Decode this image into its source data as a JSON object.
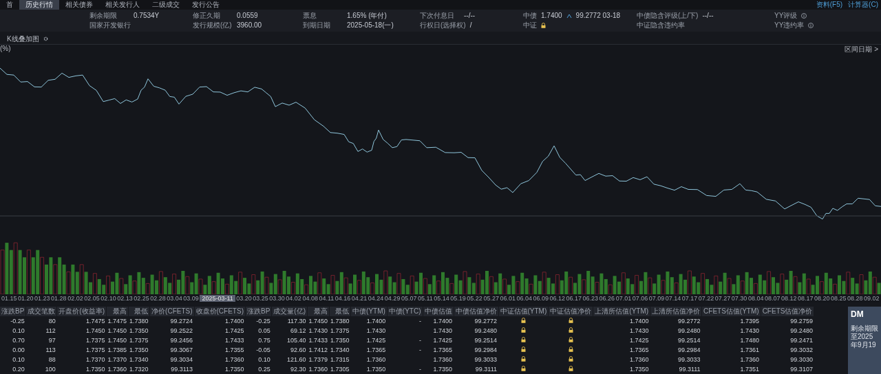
{
  "top_tabs": [
    {
      "label": "首",
      "selected": false
    },
    {
      "label": "历史行情",
      "selected": true
    },
    {
      "label": "相关债券",
      "selected": false
    },
    {
      "label": "相关发行人",
      "selected": false
    },
    {
      "label": "二级成交",
      "selected": false
    },
    {
      "label": "发行公告",
      "selected": false
    }
  ],
  "links": [
    "资料(F5)",
    "计算器(C)"
  ],
  "info_rows": [
    [
      {
        "kind": "pair",
        "label": "剩余期限",
        "value": "0.7534Y"
      },
      {
        "kind": "pair",
        "label": "修正久期",
        "value": "0.0559"
      },
      {
        "kind": "pair",
        "label": "票息",
        "value": "1.65% (年付)"
      },
      {
        "kind": "pair",
        "label": "下次付息日",
        "value": "--/--"
      },
      {
        "kind": "valuation",
        "label": "中债",
        "value": "1.7400",
        "extra": "99.2772 03-18"
      },
      {
        "kind": "pair",
        "label": "中债隐含评级(上/下)",
        "value": "--/--"
      },
      {
        "kind": "info",
        "label": "YY评级"
      }
    ],
    [
      {
        "kind": "pair",
        "label": "国家开发银行"
      },
      {
        "kind": "pair",
        "label": "发行规模(亿)",
        "value": "3960.00"
      },
      {
        "kind": "pair",
        "label": "到期日期",
        "value": "2025-05-18(一)"
      },
      {
        "kind": "pair",
        "label": "行权日(选择权)",
        "value": "/"
      },
      {
        "kind": "locked",
        "label": "中证"
      },
      {
        "kind": "pair",
        "label": "中证隐含违约率"
      },
      {
        "kind": "info",
        "label": "YY违约率"
      }
    ]
  ],
  "chart_toolbar": {
    "label": "K线叠加图",
    "unit": "(%)",
    "range_button": "区间日期 >"
  },
  "x_axis_labels": [
    {
      "kind": "tick",
      "label": "01.15"
    },
    {
      "kind": "tick",
      "label": "01.20"
    },
    {
      "kind": "tick",
      "label": "01.23"
    },
    {
      "kind": "tick",
      "label": "01.28"
    },
    {
      "kind": "tick",
      "label": "02.02"
    },
    {
      "kind": "tick",
      "label": "02.05"
    },
    {
      "kind": "tick",
      "label": "02.10"
    },
    {
      "kind": "tick",
      "label": "02.13"
    },
    {
      "kind": "tick",
      "label": "02.25"
    },
    {
      "kind": "tick",
      "label": "02.28"
    },
    {
      "kind": "tick",
      "label": "03.04"
    },
    {
      "kind": "tick",
      "label": "03.09"
    },
    {
      "kind": "crosshair",
      "label": "2025-03-11"
    },
    {
      "kind": "tick",
      "label": "03.20"
    },
    {
      "kind": "tick",
      "label": "03.25"
    },
    {
      "kind": "tick",
      "label": "03.30"
    },
    {
      "kind": "tick",
      "label": "04.02"
    },
    {
      "kind": "tick",
      "label": "04.08"
    },
    {
      "kind": "tick",
      "label": "04.11"
    },
    {
      "kind": "tick",
      "label": "04.16"
    },
    {
      "kind": "tick",
      "label": "04.21"
    },
    {
      "kind": "tick",
      "label": "04.24"
    },
    {
      "kind": "tick",
      "label": "04.29"
    },
    {
      "kind": "tick",
      "label": "05.07"
    },
    {
      "kind": "tick",
      "label": "05.11"
    },
    {
      "kind": "tick",
      "label": "05.14"
    },
    {
      "kind": "tick",
      "label": "05.19"
    },
    {
      "kind": "tick",
      "label": "05.22"
    },
    {
      "kind": "tick",
      "label": "05.27"
    },
    {
      "kind": "tick",
      "label": "06.01"
    },
    {
      "kind": "tick",
      "label": "06.04"
    },
    {
      "kind": "tick",
      "label": "06.09"
    },
    {
      "kind": "tick",
      "label": "06.12"
    },
    {
      "kind": "tick",
      "label": "06.17"
    },
    {
      "kind": "tick",
      "label": "06.23"
    },
    {
      "kind": "tick",
      "label": "06.26"
    },
    {
      "kind": "tick",
      "label": "07.01"
    },
    {
      "kind": "tick",
      "label": "07.06"
    },
    {
      "kind": "tick",
      "label": "07.09"
    },
    {
      "kind": "tick",
      "label": "07.14"
    },
    {
      "kind": "tick",
      "label": "07.17"
    },
    {
      "kind": "tick",
      "label": "07.22"
    },
    {
      "kind": "tick",
      "label": "07.27"
    },
    {
      "kind": "tick",
      "label": "07.30"
    },
    {
      "kind": "tick",
      "label": "08.04"
    },
    {
      "kind": "tick",
      "label": "08.07"
    },
    {
      "kind": "tick",
      "label": "08.12"
    },
    {
      "kind": "tick",
      "label": "08.17"
    },
    {
      "kind": "tick",
      "label": "08.20"
    },
    {
      "kind": "tick",
      "label": "08.25"
    },
    {
      "kind": "tick",
      "label": "08.28"
    },
    {
      "kind": "tick",
      "label": "09.02"
    }
  ],
  "table": {
    "columns": [
      {
        "label": "涨跌BP",
        "kind": "text"
      },
      {
        "label": "成交笔数",
        "kind": "text"
      },
      {
        "label": "开盘价(收益率)",
        "kind": "text"
      },
      {
        "label": "最高",
        "kind": "text"
      },
      {
        "label": "最低",
        "kind": "text"
      },
      {
        "label": "净价(CFETS)",
        "kind": "text"
      },
      {
        "label": "收盘价(CFETS)",
        "kind": "text"
      },
      {
        "label": "涨跌BP",
        "kind": "text"
      },
      {
        "label": "成交量(亿)",
        "kind": "text"
      },
      {
        "label": "最高",
        "kind": "text"
      },
      {
        "label": "最低",
        "kind": "text"
      },
      {
        "label": "中债(YTM)",
        "kind": "text"
      },
      {
        "label": "中债(YTC)",
        "kind": "text"
      },
      {
        "label": "中债估值",
        "kind": "text"
      },
      {
        "label": "中债估值净价",
        "kind": "text"
      },
      {
        "label": "中证估值(YTM)",
        "kind": "lock"
      },
      {
        "label": "中证估值净价",
        "kind": "lock"
      },
      {
        "label": "上清所估值(YTM)",
        "kind": "text"
      },
      {
        "label": "上清所估值净价",
        "kind": "text"
      },
      {
        "label": "CFETS估值(YTM)",
        "kind": "text"
      },
      {
        "label": "CFETS估值净价",
        "kind": "text"
      }
    ],
    "rows": [
      [
        "-0.25",
        "80",
        "1.7475",
        "1.7475",
        "1.7380",
        "99.2724",
        "1.7400",
        "-0.25",
        "117.30",
        "1.7450",
        "1.7380",
        "1.7400",
        "-",
        "1.7400",
        "99.2772",
        "",
        "",
        "1.7400",
        "99.2772",
        "1.7395",
        "99.2759"
      ],
      [
        "0.10",
        "112",
        "1.7450",
        "1.7450",
        "1.7350",
        "99.2522",
        "1.7425",
        "0.05",
        "69.12",
        "1.7430",
        "1.7375",
        "1.7430",
        "",
        "1.7430",
        "99.2480",
        "",
        "",
        "1.7430",
        "99.2480",
        "1.7430",
        "99.2480"
      ],
      [
        "0.70",
        "97",
        "1.7375",
        "1.7450",
        "1.7375",
        "99.2456",
        "1.7433",
        "0.75",
        "105.40",
        "1.7433",
        "1.7350",
        "1.7425",
        "-",
        "1.7425",
        "99.2514",
        "",
        "",
        "1.7425",
        "99.2514",
        "1.7480",
        "99.2471"
      ],
      [
        "0.00",
        "113",
        "1.7375",
        "1.7385",
        "1.7350",
        "99.3067",
        "1.7355",
        "-0.05",
        "92.60",
        "1.7412",
        "1.7340",
        "1.7365",
        "-",
        "1.7365",
        "99.2984",
        "",
        "",
        "1.7365",
        "99.2984",
        "1.7361",
        "99.3032"
      ],
      [
        "0.10",
        "88",
        "1.7370",
        "1.7370",
        "1.7340",
        "99.3034",
        "1.7360",
        "0.10",
        "121.60",
        "1.7379",
        "1.7315",
        "1.7360",
        "",
        "1.7360",
        "99.3033",
        "",
        "",
        "1.7360",
        "99.3033",
        "1.7360",
        "99.3030"
      ],
      [
        "0.20",
        "100",
        "1.7350",
        "1.7360",
        "1.7320",
        "99.3113",
        "1.7350",
        "0.25",
        "92.30",
        "1.7360",
        "1.7305",
        "1.7350",
        "-",
        "1.7350",
        "99.3111",
        "",
        "",
        "1.7350",
        "99.3111",
        "1.7351",
        "99.3107"
      ]
    ]
  },
  "side_panel": {
    "title": "DM",
    "text": "剩余期限至2025年9月19"
  }
}
